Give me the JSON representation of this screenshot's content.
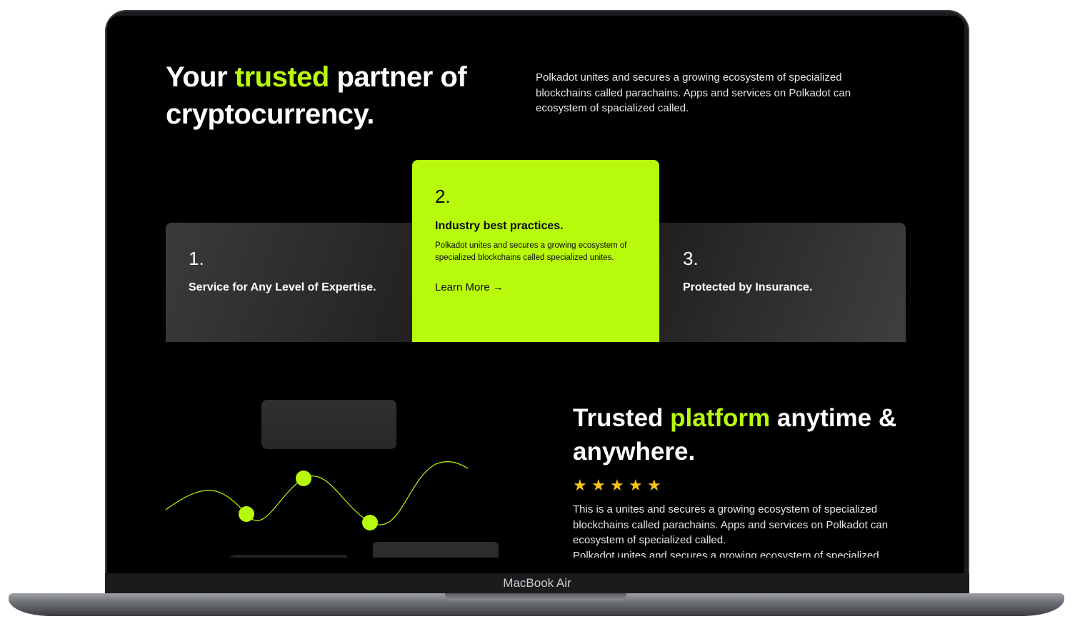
{
  "hero": {
    "title_before": "Your ",
    "title_accent": "trusted",
    "title_after": " partner of cryptocurrency.",
    "description": "Polkadot unites and secures a growing ecosystem of specialized blockchains called parachains. Apps and services on Polkadot can ecosystem of spacialized called."
  },
  "cards": [
    {
      "number": "1.",
      "title": "Service for Any Level of Expertise."
    },
    {
      "number": "2.",
      "title": "Industry best practices.",
      "description": "Polkadot unites and secures a growing ecosystem of specialized blockchains called specialized unites.",
      "link": "Learn More →"
    },
    {
      "number": "3.",
      "title": "Protected by Insurance."
    }
  ],
  "trust": {
    "title_before": "Trusted ",
    "title_accent": "platform",
    "title_after": " anytime & anywhere.",
    "rating_stars": 5,
    "star_glyph": "★",
    "description": "This is a unites and secures a growing ecosystem of specialized blockchains called parachains. Apps and services on Polkadot can ecosystem of specialized called.",
    "description_2": "Polkadot unites and secures a growing ecosystem of specialized"
  },
  "device": {
    "label": "MacBook Air"
  },
  "colors": {
    "accent": "#b8fa0c",
    "background": "#000000",
    "star": "#f5c518"
  }
}
